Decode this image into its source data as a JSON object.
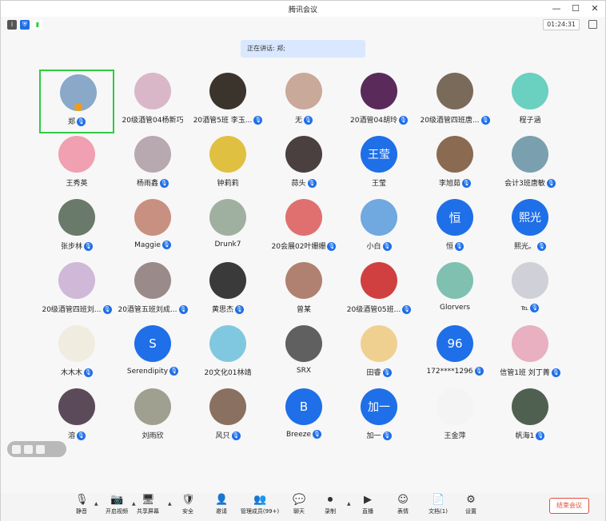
{
  "window": {
    "title": "腾讯会议"
  },
  "status": {
    "timer": "01:24:31"
  },
  "speaking": {
    "label": "正在讲话: 郑;"
  },
  "participants": [
    {
      "name": "郑",
      "mic": true,
      "avatar_color": "#8aa8c8",
      "active": true,
      "host": true
    },
    {
      "name": "20级酒管04杨新巧",
      "mic": false,
      "avatar_color": "#d9b7c8"
    },
    {
      "name": "20酒管5班 李玉...",
      "mic": true,
      "avatar_color": "#3b342c"
    },
    {
      "name": "无",
      "mic": true,
      "avatar_color": "#c9a99a"
    },
    {
      "name": "20酒管04胡玲",
      "mic": true,
      "avatar_color": "#5a2a5a"
    },
    {
      "name": "20级酒管四班唐...",
      "mic": true,
      "avatar_color": "#7a6a5a"
    },
    {
      "name": "程子涵",
      "mic": false,
      "avatar_color": "#6ad0c0"
    },
    {
      "name": "王秀英",
      "mic": false,
      "avatar_color": "#f0a0b0"
    },
    {
      "name": "杨雨鑫",
      "mic": true,
      "avatar_color": "#b8a8b0"
    },
    {
      "name": "钟莉莉",
      "mic": false,
      "avatar_color": "#e0c040"
    },
    {
      "name": "蒜头",
      "mic": true,
      "avatar_color": "#4a4040"
    },
    {
      "name": "王莹",
      "mic": false,
      "avatar_text": "王莹",
      "avatar_color": "#1e6fe8"
    },
    {
      "name": "李旭茹",
      "mic": true,
      "avatar_color": "#8a6a50"
    },
    {
      "name": "会计3班唐敏",
      "mic": true,
      "avatar_color": "#7aa0b0"
    },
    {
      "name": "张步林",
      "mic": true,
      "avatar_color": "#6a7a6a"
    },
    {
      "name": "Maggie",
      "mic": true,
      "avatar_color": "#c89080"
    },
    {
      "name": "Drunk7",
      "mic": false,
      "avatar_color": "#a0b0a0"
    },
    {
      "name": "20会展02叶姗姗",
      "mic": true,
      "avatar_color": "#e07070"
    },
    {
      "name": "小白",
      "mic": true,
      "avatar_color": "#70a8e0"
    },
    {
      "name": "恒",
      "mic": true,
      "avatar_text": "恒",
      "avatar_color": "#1e6fe8"
    },
    {
      "name": "熙光。",
      "mic": true,
      "avatar_text": "熙光",
      "avatar_color": "#1e6fe8"
    },
    {
      "name": "20级酒管四班刘...",
      "mic": true,
      "avatar_color": "#d0b8d8"
    },
    {
      "name": "20酒管五班刘成...",
      "mic": true,
      "avatar_color": "#9a8a8a"
    },
    {
      "name": "黄思杰",
      "mic": true,
      "avatar_color": "#3a3a3a"
    },
    {
      "name": "曾某",
      "mic": false,
      "avatar_color": "#b08070"
    },
    {
      "name": "20级酒管05班...",
      "mic": true,
      "avatar_color": "#d04040"
    },
    {
      "name": "Glorvers",
      "mic": false,
      "avatar_color": "#80c0b0"
    },
    {
      "name": "℡",
      "mic": true,
      "avatar_color": "#d0d0d8"
    },
    {
      "name": "木木木",
      "mic": true,
      "avatar_color": "#f0ece0"
    },
    {
      "name": "Serendipity",
      "mic": true,
      "avatar_text": "S",
      "avatar_color": "#1e6fe8"
    },
    {
      "name": "20文化01林靖",
      "mic": false,
      "avatar_color": "#80c8e0"
    },
    {
      "name": "SRX",
      "mic": false,
      "avatar_color": "#606060"
    },
    {
      "name": "田睿",
      "mic": true,
      "avatar_color": "#f0d090"
    },
    {
      "name": "172****1296",
      "mic": true,
      "avatar_text": "96",
      "avatar_color": "#1e6fe8"
    },
    {
      "name": "信管1班 刘丁菁",
      "mic": true,
      "avatar_color": "#e8b0c0"
    },
    {
      "name": "溶",
      "mic": true,
      "avatar_color": "#5a4a5a"
    },
    {
      "name": "刘雨欣",
      "mic": false,
      "avatar_color": "#a0a090"
    },
    {
      "name": "风只",
      "mic": true,
      "avatar_color": "#8a7060"
    },
    {
      "name": "Breeze",
      "mic": true,
      "avatar_text": "B",
      "avatar_color": "#1e6fe8"
    },
    {
      "name": "加一",
      "mic": true,
      "avatar_text": "加一",
      "avatar_color": "#1e6fe8"
    },
    {
      "name": "王金萍",
      "mic": false,
      "avatar_color": "#f4f4f4"
    },
    {
      "name": "帆海1",
      "mic": true,
      "avatar_color": "#506050"
    }
  ],
  "toolbar": {
    "items": [
      {
        "label": "静音",
        "icon": "mic-icon",
        "glyph": "🎙"
      },
      {
        "label": "开启视频",
        "icon": "camera-off-icon",
        "glyph": "📷"
      },
      {
        "label": "共享屏幕",
        "icon": "share-screen-icon",
        "glyph": "🖥"
      },
      {
        "label": "安全",
        "icon": "shield-icon",
        "glyph": "🛡"
      },
      {
        "label": "邀请",
        "icon": "invite-icon",
        "glyph": "👤"
      },
      {
        "label": "管理成员(99+)",
        "icon": "members-icon",
        "glyph": "👥"
      },
      {
        "label": "聊天",
        "icon": "chat-icon",
        "glyph": "💬"
      },
      {
        "label": "录制",
        "icon": "record-icon",
        "glyph": "⏺"
      },
      {
        "label": "直播",
        "icon": "live-icon",
        "glyph": "▶"
      },
      {
        "label": "表情",
        "icon": "emoji-icon",
        "glyph": "☺"
      },
      {
        "label": "文档(1)",
        "icon": "document-icon",
        "glyph": "📄"
      },
      {
        "label": "设置",
        "icon": "gear-icon",
        "glyph": "⚙"
      }
    ],
    "end_label": "结束会议"
  }
}
